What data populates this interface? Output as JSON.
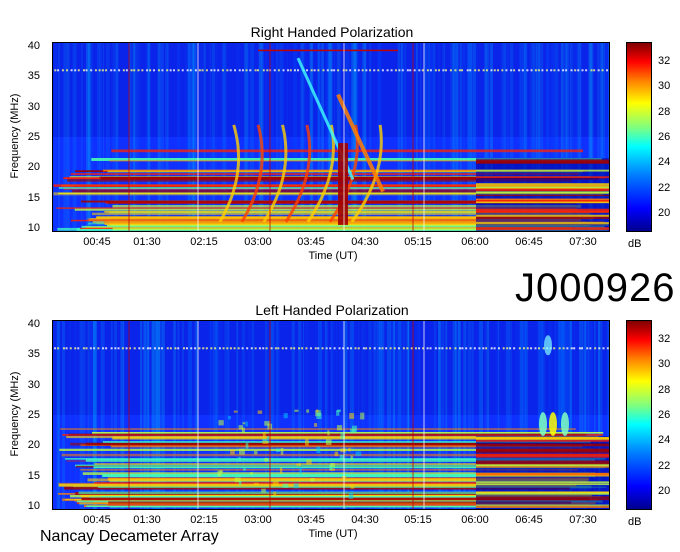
{
  "identifier": "J000926",
  "source_label": "Nancay Decameter Array",
  "chart_data": [
    {
      "type": "heatmap",
      "title": "Right Handed Polarization",
      "xlabel": "Time (UT)",
      "ylabel": "Frequency (MHz)",
      "x_ticks": [
        "00:45",
        "01:30",
        "02:15",
        "03:00",
        "03:45",
        "04:30",
        "05:15",
        "06:00",
        "06:45",
        "07:30"
      ],
      "y_ticks": [
        "10",
        "15",
        "20",
        "25",
        "30",
        "35",
        "40"
      ],
      "ylim": [
        10,
        40
      ],
      "colorbar": {
        "label": "dB",
        "ticks": [
          "20",
          "22",
          "24",
          "26",
          "28",
          "30",
          "32"
        ],
        "range": [
          18.5,
          33.5
        ],
        "colormap": "jet"
      }
    },
    {
      "type": "heatmap",
      "title": "Left Handed Polarization",
      "xlabel": "Time (UT)",
      "ylabel": "Frequency (MHz)",
      "x_ticks": [
        "00:45",
        "01:30",
        "02:15",
        "03:00",
        "03:45",
        "04:30",
        "05:15",
        "06:00",
        "06:45",
        "07:30"
      ],
      "y_ticks": [
        "10",
        "15",
        "20",
        "25",
        "30",
        "35",
        "40"
      ],
      "ylim": [
        10,
        40
      ],
      "colorbar": {
        "label": "dB",
        "ticks": [
          "20",
          "22",
          "24",
          "26",
          "28",
          "30",
          "32"
        ],
        "range": [
          18.5,
          33.5
        ],
        "colormap": "jet"
      }
    }
  ]
}
